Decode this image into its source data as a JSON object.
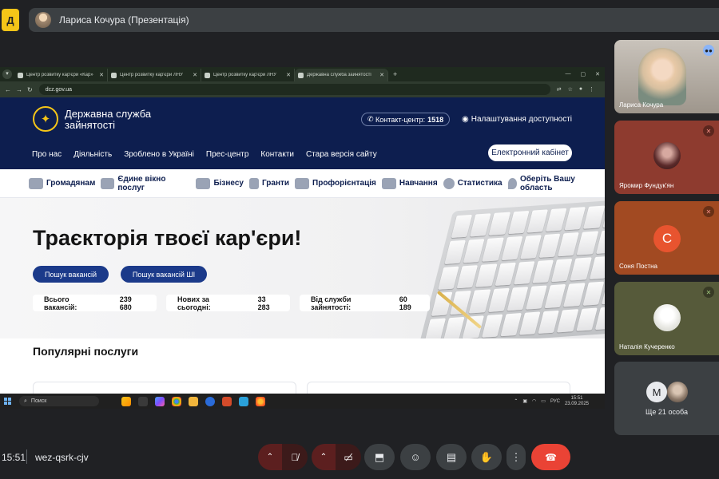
{
  "meet": {
    "logo_letter": "Д",
    "presenter_label": "Лариса Кочура (Презентація)",
    "time": "15:51",
    "meeting_code": "wez-qsrk-cjv"
  },
  "browser": {
    "tabs": [
      {
        "title": "Центр розвитку кар'єри «Кар»",
        "active": false
      },
      {
        "title": "Центр розвитку кар'єри ЛНУ",
        "active": false
      },
      {
        "title": "Центр розвитку кар'єри ЛНУ",
        "active": false
      },
      {
        "title": "Державна служба зайнятості",
        "active": true
      }
    ],
    "url": "dcz.gov.ua"
  },
  "site": {
    "name": "Державна служба зайнятості",
    "contact_label": "Контакт-центр:",
    "contact_number": "1518",
    "accessibility": "Налаштування доступності",
    "nav": [
      "Про нас",
      "Діяльність",
      "Зроблено в Україні",
      "Прес-центр",
      "Контакти",
      "Стара версія сайту"
    ],
    "cabinet": "Електронний кабінет",
    "categories": [
      "Громадянам",
      "Єдине вікно послуг",
      "Бізнесу",
      "Гранти",
      "Профорієнтація",
      "Навчання",
      "Статистика",
      "Оберіть Вашу область"
    ],
    "hero_title": "Траєкторія твоєї кар'єри!",
    "btn_search": "Пошук вакансій",
    "btn_search_ai": "Пошук вакансій ШІ",
    "stats": [
      {
        "label": "Всього вакансій:",
        "value": "239 680"
      },
      {
        "label": "Нових за сьогодні:",
        "value": "33 283"
      },
      {
        "label": "Від служби зайнятості:",
        "value": "60 189"
      }
    ],
    "popular_title": "Популярні послуги"
  },
  "taskbar": {
    "search_placeholder": "Поиск",
    "lang": "РУС",
    "clock_time": "15:51",
    "clock_date": "23.09.2025"
  },
  "participants": [
    {
      "name": "Лариса Кочура"
    },
    {
      "name": "Яромир Фундук'ян"
    },
    {
      "name": "Соня Постна",
      "initial": "С"
    },
    {
      "name": "Наталія Кучеренко"
    }
  ],
  "more_participants": {
    "initial": "М",
    "label": "Ще 21 особа"
  },
  "colors": {
    "site_header": "#0d1e4f",
    "primary_button": "#1b3a8a",
    "hangup": "#ea4335"
  }
}
